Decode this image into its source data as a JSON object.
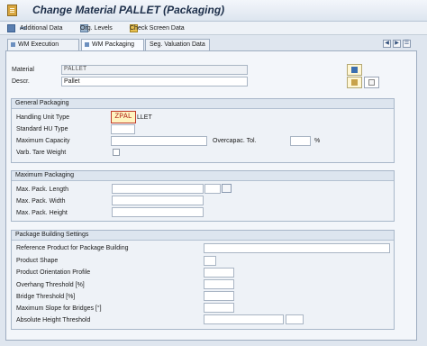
{
  "window": {
    "title": "Change Material PALLET (Packaging)"
  },
  "toolbar": {
    "additional_data": "Additional Data",
    "org_levels": "Org. Levels",
    "check_screen_data": "Check Screen Data"
  },
  "tabs": [
    {
      "label": "WM Execution"
    },
    {
      "label": "WM Packaging",
      "active": true
    },
    {
      "label": "Seg. Valuation Data"
    }
  ],
  "header": {
    "material_label": "Material",
    "material_value": "PALLET",
    "descr_label": "Descr.",
    "descr_value": "Pallet"
  },
  "general_packaging": {
    "title": "General Packaging",
    "hu_type_label": "Handling Unit Type",
    "hu_type_value": "ZPAL",
    "hu_type_suffix": "LLET",
    "std_hu_type_label": "Standard HU Type",
    "max_capacity_label": "Maximum Capacity",
    "overcap_label": "Overcapac. Tol.",
    "percent": "%",
    "varb_tare_label": "Varb. Tare Weight"
  },
  "maximum_packaging": {
    "title": "Maximum Packaging",
    "length_label": "Max. Pack. Length",
    "width_label": "Max. Pack. Width",
    "height_label": "Max. Pack. Height"
  },
  "package_building": {
    "title": "Package Building Settings",
    "ref_product_label": "Reference Product for Package Building",
    "shape_label": "Product Shape",
    "orientation_label": "Product Orientation Profile",
    "overhang_label": "Overhang Threshold [%]",
    "bridge_label": "Bridge Threshold [%]",
    "slope_label": "Maximum Slope for Bridges [°]",
    "abs_height_label": "Absolute Height Threshold"
  }
}
